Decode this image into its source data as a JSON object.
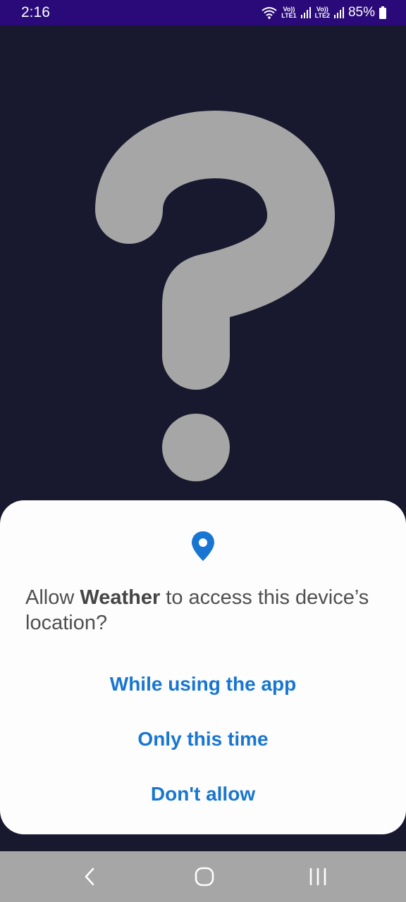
{
  "status_bar": {
    "time": "2:16",
    "sim1_top": "Vo))",
    "sim1_bottom": "LTE1",
    "sim2_top": "Vo))",
    "sim2_bottom": "LTE2",
    "battery_percent": "85%"
  },
  "background": {
    "glyph": "question-mark",
    "glyph_color": "#a6a6a6",
    "background_color": "#18182e"
  },
  "dialog": {
    "icon": "location-pin-icon",
    "accent_color": "#1876d2",
    "message_prefix": "Allow ",
    "app_name": "Weather",
    "message_suffix": " to access this device’s location?",
    "buttons": {
      "while_using": "While using the app",
      "only_this_time": "Only this time",
      "dont_allow": "Don't allow"
    }
  },
  "nav_bar": {
    "back": "back-icon",
    "home": "home-icon",
    "recents": "recents-icon"
  }
}
